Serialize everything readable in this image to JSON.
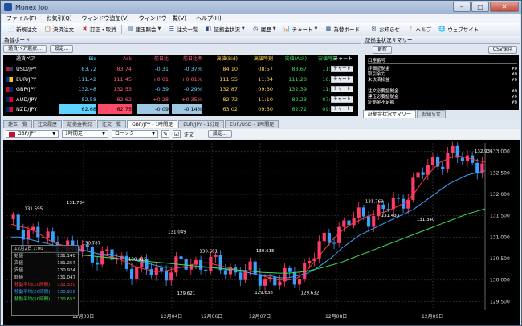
{
  "window": {
    "title": "Monex Joo"
  },
  "menu": [
    "ファイル(F)",
    "お気引(Q)",
    "ウィンドウ追加(V)",
    "ウィンドウ一覧(V)",
    "ヘルプ(H)"
  ],
  "toolbar": [
    {
      "label": "新規注文",
      "icon": "new-order-icon",
      "caret": false
    },
    {
      "label": "決済注文",
      "icon": "settle-order-icon",
      "caret": false
    },
    {
      "label": "訂正・取消",
      "icon": "cancel-icon",
      "caret": false
    },
    {
      "label": "建玉照会",
      "icon": "position-icon",
      "caret": true
    },
    {
      "label": "注文一覧",
      "icon": "order-list-icon",
      "caret": false
    },
    {
      "label": "証拠金状況",
      "icon": "margin-icon",
      "caret": true
    },
    {
      "label": "履歴",
      "icon": "history-icon",
      "caret": true
    },
    {
      "label": "チャート",
      "icon": "chart-icon",
      "caret": true
    },
    {
      "label": "為替ボード",
      "icon": "fx-board-icon",
      "caret": false
    },
    {
      "label": "お知らせ",
      "icon": "notice-icon",
      "caret": false
    },
    {
      "label": "ヘルプ",
      "icon": "help-icon",
      "caret": false
    },
    {
      "label": "ウェブサイト",
      "icon": "website-icon",
      "caret": false
    }
  ],
  "rate_board": {
    "title": "為替ボード",
    "pair_select_btn": "通貨ペア選択...",
    "settings_btn": "設定...",
    "headers": [
      "通貨ペア",
      "Bid",
      "Ask",
      "前日比",
      "前日比率",
      "高値(Bid)",
      "高値時刻",
      "安値(Ask)",
      "安値時刻",
      "チャート"
    ],
    "rows": [
      {
        "pair": "USD/JPY",
        "bid": "83.72",
        "ask": "83.74",
        "chg": "-0.31",
        "pct": "-0.37%",
        "high": "84.10",
        "high_t": "08:57",
        "low": "83.67",
        "low_t": "11:36",
        "chart": "チャート",
        "up": false
      },
      {
        "pair": "EUR/JPY",
        "bid": "111.42",
        "ask": "111.45",
        "chg": "+0.01",
        "pct": "+0.01%",
        "high": "111.55",
        "high_t": "11:04",
        "low": "111.28",
        "low_t": "10:02",
        "chart": "チャート",
        "up": true
      },
      {
        "pair": "GBP/JPY",
        "bid": "132.48",
        "ask": "132.53",
        "chg": "-0.39",
        "pct": "-0.29%",
        "high": "132.87",
        "high_t": "09:30",
        "low": "132.39",
        "low_t": "11:36",
        "chart": "チャート",
        "up": false
      },
      {
        "pair": "AUD/JPY",
        "bid": "82.58",
        "ask": "82.62",
        "chg": "+0.28",
        "pct": "+0.35%",
        "high": "82.72",
        "high_t": "11:10",
        "low": "82.23",
        "low_t": "07:14",
        "chart": "チャート",
        "up": true
      },
      {
        "pair": "NZD/JPY",
        "bid": "62.68",
        "ask": "62.75",
        "chg": "-0.09",
        "pct": "-0.14%",
        "high": "63.02",
        "high_t": "09:30",
        "low": "62.72",
        "low_t": "09:29",
        "chart": "チャート",
        "up": false
      }
    ]
  },
  "summary": {
    "title": "証拠金状況サマリー",
    "update_btn": "更新",
    "save_btn": "CSV保存",
    "account_label": "口座番号",
    "lines": [
      {
        "label": "評価証拠金",
        "value": "¥0"
      },
      {
        "label": "取引余力",
        "value": "¥0"
      },
      {
        "label": "未決済損益",
        "value": "¥0"
      },
      {
        "label": "",
        "value": ""
      },
      {
        "label": "注文必要証拠金",
        "value": "¥0"
      },
      {
        "label": "建玉必要証拠金",
        "value": "¥0"
      },
      {
        "label": "証拠金不足額",
        "value": "¥0"
      }
    ],
    "tabs": [
      "証拠金状況サマリー",
      "お知らせ"
    ]
  },
  "chart_tabs": [
    "建玉一覧",
    "注文履歴",
    "証拠金状況",
    "注文一覧",
    "GBP/JPY - 1時間足",
    "EUR/JPY - 1分足",
    "EUR/USD - 1時間足"
  ],
  "chart_tools": {
    "pair": "GBP/JPY",
    "interval": "1時間足",
    "style": "ローソク",
    "order_btn": "注文",
    "settings_btn": "設定..."
  },
  "chart_data": {
    "type": "candlestick",
    "pair": "GBP/JPY",
    "interval": "1時間足",
    "y_ticks": [
      "133.000",
      "132.500",
      "132.000",
      "131.500",
      "131.000",
      "130.500",
      "130.000",
      "129.500"
    ],
    "ylim": [
      129.3,
      133.2
    ],
    "x_ticks": [
      "12月03日",
      "12月04日",
      "12月06日",
      "12月07日",
      "12月08日",
      "12月09日"
    ],
    "annotations": [
      {
        "text": "131.595",
        "x": 10,
        "y": 131.595
      },
      {
        "text": "131.734",
        "x": 42,
        "y": 131.734
      },
      {
        "text": "131.049",
        "x": 119,
        "y": 131.049
      },
      {
        "text": "130.787",
        "x": 54,
        "y": 130.787
      },
      {
        "text": "130.415",
        "x": 89,
        "y": 130.415
      },
      {
        "text": "130.601",
        "x": 143,
        "y": 130.601
      },
      {
        "text": "130.615",
        "x": 186,
        "y": 130.615
      },
      {
        "text": "129.621",
        "x": 126,
        "y": 129.621
      },
      {
        "text": "129.638",
        "x": 185,
        "y": 129.638
      },
      {
        "text": "129.632",
        "x": 220,
        "y": 129.632
      },
      {
        "text": "131.769",
        "x": 269,
        "y": 131.769
      },
      {
        "text": "131.433",
        "x": 281,
        "y": 131.433
      },
      {
        "text": "131.340",
        "x": 308,
        "y": 131.34
      },
      {
        "text": "132.936",
        "x": 352,
        "y": 132.936
      }
    ],
    "series": [
      {
        "name": "移動平均(10時間)",
        "color": "#ff3b3b",
        "values": [
          131.3,
          131.25,
          131.2,
          131.1,
          130.95,
          130.85,
          130.8,
          130.75,
          130.7,
          130.65,
          130.6,
          130.55,
          130.5,
          130.4,
          130.3,
          130.25,
          130.2,
          130.2,
          130.25,
          130.3,
          130.35,
          130.4,
          130.4,
          130.35,
          130.3,
          130.25,
          130.2,
          130.15,
          130.1,
          130.05,
          130.0,
          130.0,
          130.05,
          130.2,
          130.45,
          130.7,
          130.95,
          131.15,
          131.3,
          131.4,
          131.5,
          131.55,
          131.6,
          131.7,
          131.8,
          132.0,
          132.3,
          132.55,
          132.75,
          132.85,
          132.9,
          132.85,
          132.8,
          132.75
        ]
      },
      {
        "name": "移動平均(20時間)",
        "color": "#3aa0ff",
        "values": [
          131.0,
          131.0,
          130.95,
          130.9,
          130.85,
          130.8,
          130.75,
          130.72,
          130.7,
          130.65,
          130.6,
          130.6,
          130.55,
          130.5,
          130.45,
          130.4,
          130.35,
          130.3,
          130.3,
          130.3,
          130.3,
          130.3,
          130.3,
          130.28,
          130.25,
          130.2,
          130.2,
          130.15,
          130.1,
          130.1,
          130.05,
          130.05,
          130.1,
          130.15,
          130.25,
          130.4,
          130.55,
          130.75,
          130.9,
          131.05,
          131.15,
          131.25,
          131.35,
          131.45,
          131.55,
          131.65,
          131.8,
          131.95,
          132.1,
          132.25,
          132.35,
          132.45,
          132.5,
          132.55
        ]
      },
      {
        "name": "移動平均(50時間)",
        "color": "#3ddc5a",
        "values": [
          130.7,
          130.7,
          130.7,
          130.68,
          130.66,
          130.64,
          130.62,
          130.6,
          130.58,
          130.56,
          130.54,
          130.52,
          130.5,
          130.48,
          130.46,
          130.44,
          130.42,
          130.4,
          130.38,
          130.36,
          130.34,
          130.32,
          130.3,
          130.28,
          130.26,
          130.24,
          130.22,
          130.2,
          130.18,
          130.17,
          130.16,
          130.16,
          130.18,
          130.2,
          130.25,
          130.3,
          130.36,
          130.42,
          130.5,
          130.58,
          130.66,
          130.74,
          130.82,
          130.9,
          130.98,
          131.06,
          131.14,
          131.22,
          131.3,
          131.38,
          131.46,
          131.54,
          131.6,
          131.66
        ]
      }
    ],
    "legend_box": {
      "date": "12月2日 1:00",
      "rows": [
        {
          "label": "始値",
          "value": "131.140"
        },
        {
          "label": "高値",
          "value": "131.257"
        },
        {
          "label": "安値",
          "value": "130.924"
        },
        {
          "label": "終値",
          "value": "131.047"
        },
        {
          "label": "移動平均(10時間)",
          "value": "131.320"
        },
        {
          "label": "移動平均(20時間)",
          "value": "130.926"
        },
        {
          "label": "移動平均(50時間)",
          "value": "130.653"
        }
      ]
    }
  },
  "colors": {
    "up": "#ff3b6b",
    "down": "#3aa0ff",
    "bid_hl": "#5fd3ff",
    "ask_hl": "#ff4a6a"
  }
}
